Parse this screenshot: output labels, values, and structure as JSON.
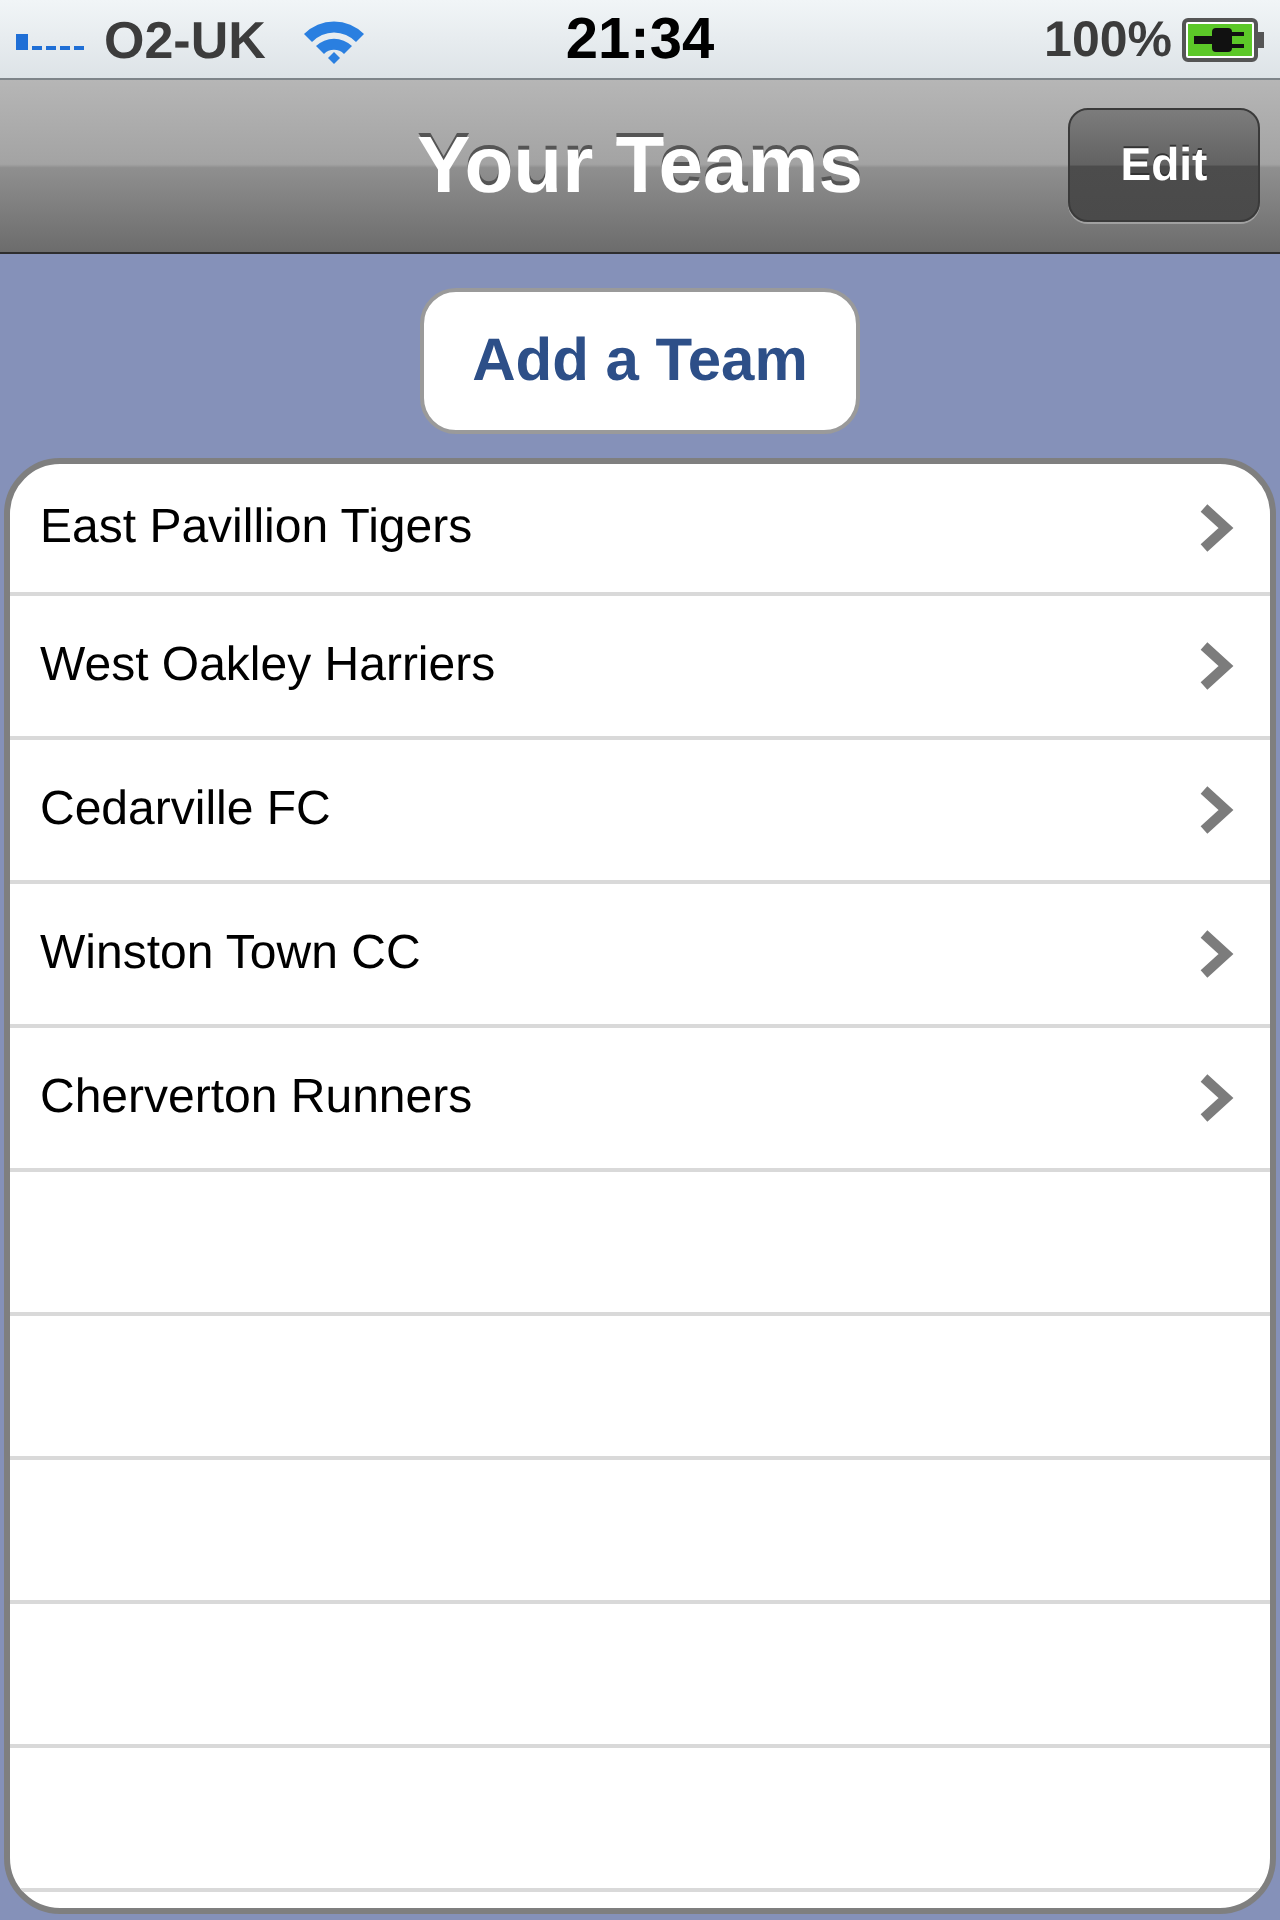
{
  "status_bar": {
    "carrier": "O2-UK",
    "time": "21:34",
    "battery": "100%",
    "charging": true
  },
  "nav_bar": {
    "title": "Your Teams",
    "edit_button": "Edit"
  },
  "add_button": "Add a Team",
  "teams": [
    {
      "name": "East Pavillion Tigers",
      "disclosure": true
    },
    {
      "name": "West Oakley Harriers",
      "disclosure": true
    },
    {
      "name": "Cedarville FC",
      "disclosure": true
    },
    {
      "name": "Winston Town CC",
      "disclosure": true
    },
    {
      "name": "Cherverton Runners",
      "disclosure": true
    }
  ]
}
